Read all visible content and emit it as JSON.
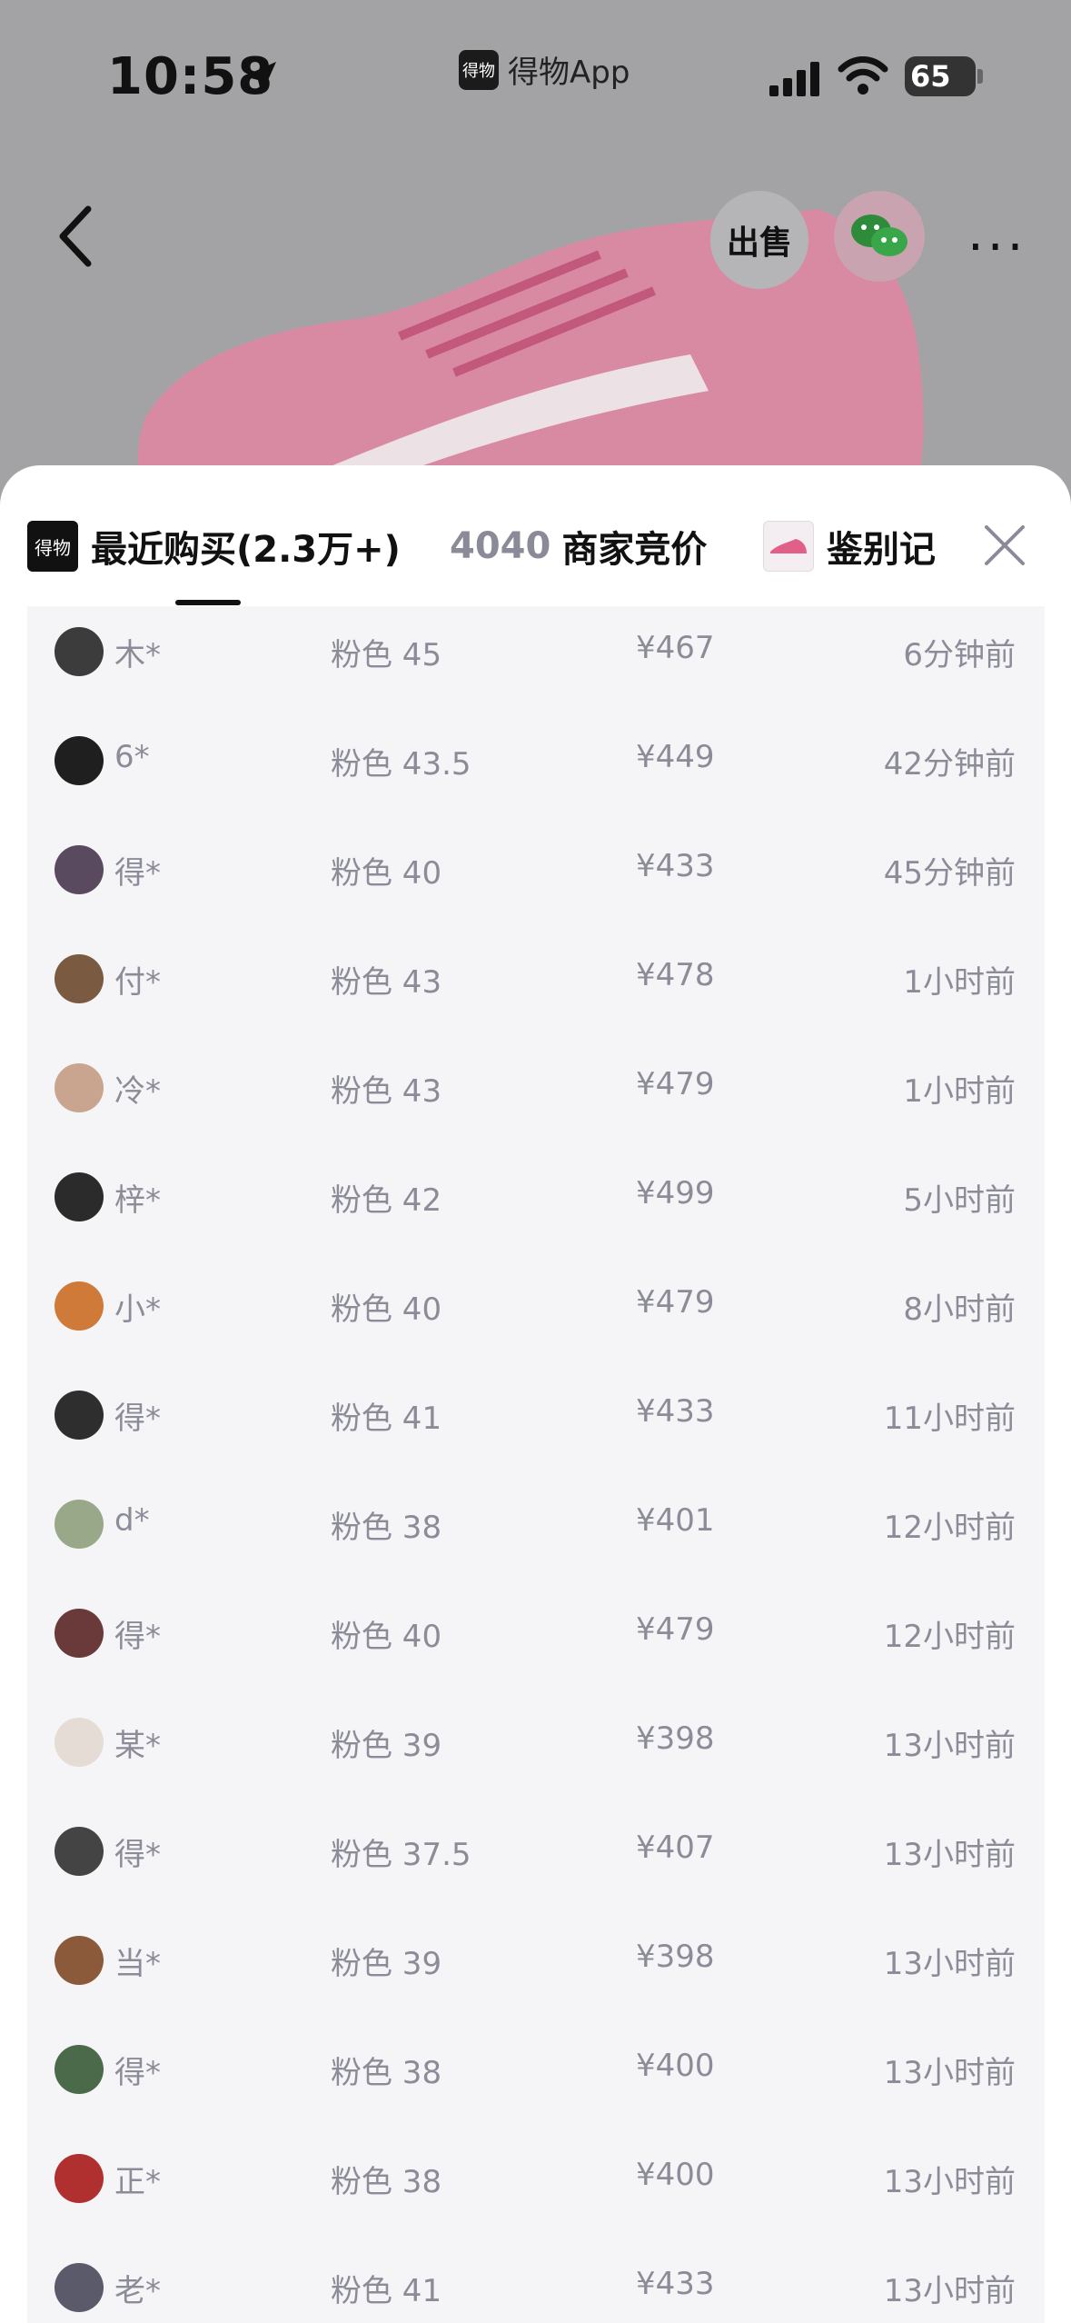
{
  "status_bar": {
    "time": "10:58",
    "app_name": "得物App",
    "app_logo_text": "得物",
    "battery": "65"
  },
  "product_header": {
    "sell_label": "出售",
    "icons": [
      "back-icon",
      "sell-icon",
      "wechat-icon",
      "more-icon"
    ]
  },
  "sheet": {
    "tab_logo_text": "得物",
    "tab_recent": "最近购买(2.3万+)",
    "tab_bid_count": "4040",
    "tab_bid_label": "商家竞价",
    "tab_identify": "鉴别记",
    "active_tab": "tab_recent"
  },
  "purchases": [
    {
      "name": "木*",
      "spec": "粉色 45",
      "price": "¥467",
      "time": "6分钟前",
      "avatar_color": "#3c3c3c"
    },
    {
      "name": "6*",
      "spec": "粉色 43.5",
      "price": "¥449",
      "time": "42分钟前",
      "avatar_color": "#1f1f1f"
    },
    {
      "name": "得*",
      "spec": "粉色 40",
      "price": "¥433",
      "time": "45分钟前",
      "avatar_color": "#5a4a60"
    },
    {
      "name": "付*",
      "spec": "粉色 43",
      "price": "¥478",
      "time": "1小时前",
      "avatar_color": "#7a5a40"
    },
    {
      "name": "冷*",
      "spec": "粉色 43",
      "price": "¥479",
      "time": "1小时前",
      "avatar_color": "#c9a58f"
    },
    {
      "name": "梓*",
      "spec": "粉色 42",
      "price": "¥499",
      "time": "5小时前",
      "avatar_color": "#2b2b2b"
    },
    {
      "name": "小*",
      "spec": "粉色 40",
      "price": "¥479",
      "time": "8小时前",
      "avatar_color": "#d07a3a"
    },
    {
      "name": "得*",
      "spec": "粉色 41",
      "price": "¥433",
      "time": "11小时前",
      "avatar_color": "#2e2e2e"
    },
    {
      "name": "d*",
      "spec": "粉色 38",
      "price": "¥401",
      "time": "12小时前",
      "avatar_color": "#9aa88a"
    },
    {
      "name": "得*",
      "spec": "粉色 40",
      "price": "¥479",
      "time": "12小时前",
      "avatar_color": "#6a3a3a"
    },
    {
      "name": "某*",
      "spec": "粉色 39",
      "price": "¥398",
      "time": "13小时前",
      "avatar_color": "#e6dcd6"
    },
    {
      "name": "得*",
      "spec": "粉色 37.5",
      "price": "¥407",
      "time": "13小时前",
      "avatar_color": "#444444"
    },
    {
      "name": "当*",
      "spec": "粉色 39",
      "price": "¥398",
      "time": "13小时前",
      "avatar_color": "#8a5a3a"
    },
    {
      "name": "得*",
      "spec": "粉色 38",
      "price": "¥400",
      "time": "13小时前",
      "avatar_color": "#4a6a4a"
    },
    {
      "name": "正*",
      "spec": "粉色 38",
      "price": "¥400",
      "time": "13小时前",
      "avatar_color": "#b03030"
    },
    {
      "name": "老*",
      "spec": "粉色 41",
      "price": "¥433",
      "time": "13小时前",
      "avatar_color": "#5a5a6a"
    }
  ]
}
